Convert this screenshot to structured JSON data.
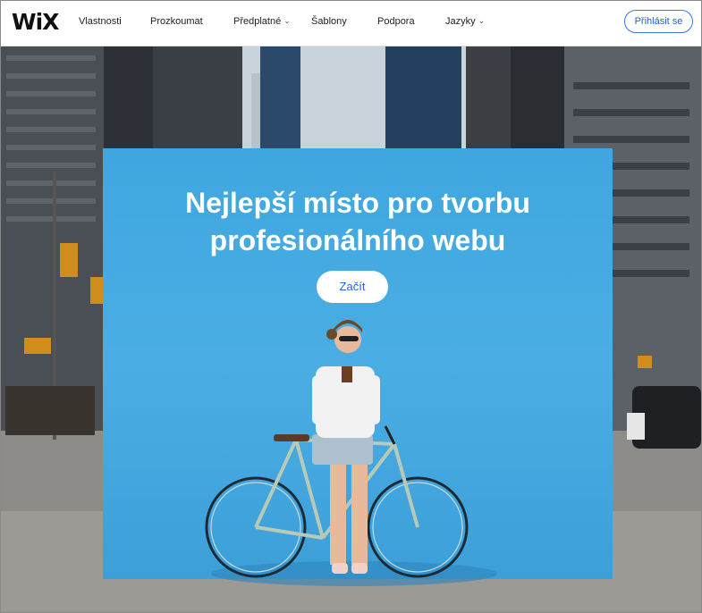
{
  "header": {
    "logo": "WiX",
    "nav": [
      {
        "label": "Vlastnosti",
        "dropdown": false
      },
      {
        "label": "Prozkoumat",
        "dropdown": false
      },
      {
        "label": "Předplatné",
        "dropdown": true
      },
      {
        "label": "Šablony",
        "dropdown": false
      },
      {
        "label": "Podpora",
        "dropdown": false
      },
      {
        "label": "Jazyky",
        "dropdown": true
      }
    ],
    "login_label": "Přihlásit se"
  },
  "hero": {
    "headline_line1": "Nejlepší místo pro tvorbu",
    "headline_line2": "profesionálního webu",
    "cta_label": "Začít"
  },
  "icons": {
    "dropdown": "chevron-down-icon"
  },
  "colors": {
    "accent": "#2463d1",
    "panel": "#45a9e1"
  }
}
